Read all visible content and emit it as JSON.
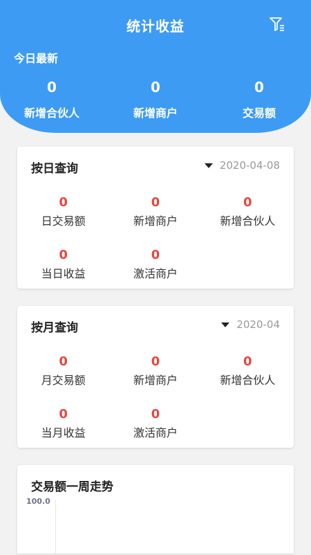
{
  "header": {
    "title": "统计收益",
    "filter_icon": "filter-icon",
    "today_label": "今日最新",
    "stats": [
      {
        "value": "0",
        "label": "新增合伙人"
      },
      {
        "value": "0",
        "label": "新增商户"
      },
      {
        "value": "0",
        "label": "交易额"
      }
    ]
  },
  "daily": {
    "title": "按日查询",
    "date": "2020-04-08",
    "items": [
      {
        "value": "0",
        "label": "日交易额"
      },
      {
        "value": "0",
        "label": "新增商户"
      },
      {
        "value": "0",
        "label": "新增合伙人"
      },
      {
        "value": "0",
        "label": "当日收益"
      },
      {
        "value": "0",
        "label": "激活商户"
      }
    ]
  },
  "monthly": {
    "title": "按月查询",
    "date": "2020-04",
    "items": [
      {
        "value": "0",
        "label": "月交易额"
      },
      {
        "value": "0",
        "label": "新增商户"
      },
      {
        "value": "0",
        "label": "新增合伙人"
      },
      {
        "value": "0",
        "label": "当月收益"
      },
      {
        "value": "0",
        "label": "激活商户"
      }
    ]
  },
  "trend": {
    "title": "交易额一周走势",
    "y_max_label": "100.0"
  },
  "colors": {
    "header_bg": "#3d9bf4",
    "value_red": "#e4473f",
    "page_bg": "#f2f2f2"
  }
}
